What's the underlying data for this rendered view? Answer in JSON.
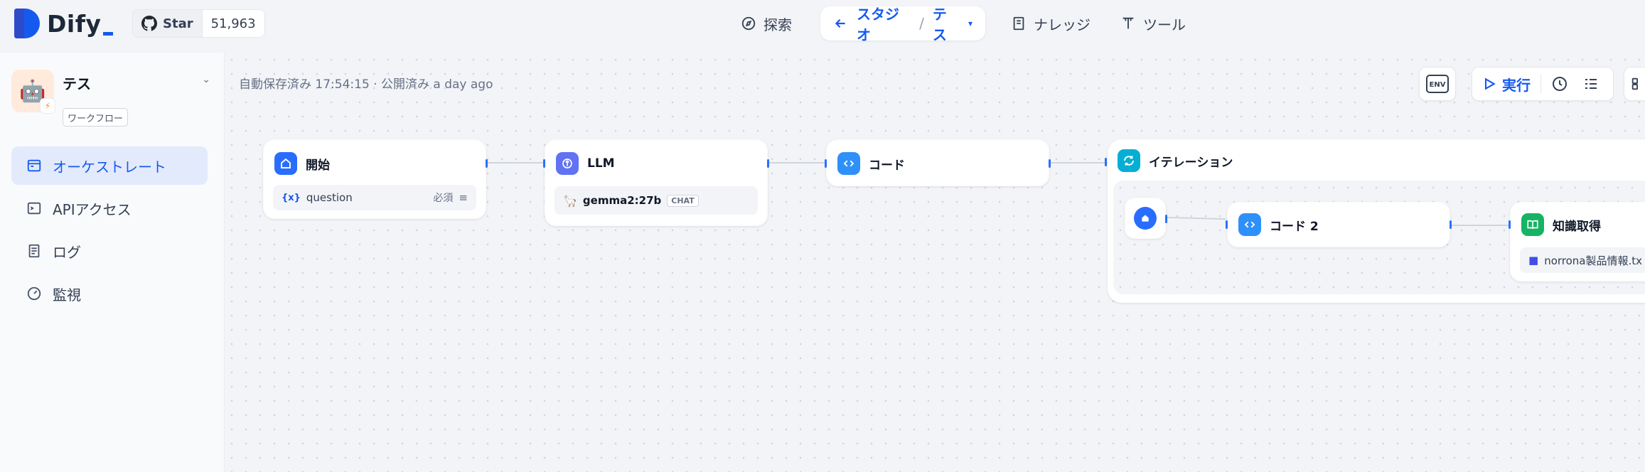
{
  "header": {
    "logo_text": "Dify",
    "github_star_label": "Star",
    "github_star_count": "51,963",
    "nav": {
      "explore": "探索",
      "studio": "スタジオ",
      "current_app": "テス",
      "knowledge": "ナレッジ",
      "tools": "ツール"
    }
  },
  "sidebar": {
    "app_name": "テス",
    "app_type": "ワークフロー",
    "items": [
      {
        "label": "オーケストレート",
        "active": true
      },
      {
        "label": "APIアクセス",
        "active": false
      },
      {
        "label": "ログ",
        "active": false
      },
      {
        "label": "監視",
        "active": false
      }
    ]
  },
  "canvas": {
    "status": "自動保存済み 17:54:15 · 公開済み a day ago",
    "env_label": "ENV",
    "run_label": "実行",
    "nodes": {
      "start": {
        "title": "開始",
        "var_name": "question",
        "required": "必須"
      },
      "llm": {
        "title": "LLM",
        "model": "gemma2:27b",
        "mode": "CHAT"
      },
      "code": {
        "title": "コード"
      },
      "iteration": {
        "title": "イテレーション"
      },
      "code2": {
        "title": "コード 2"
      },
      "knowledge": {
        "title": "知識取得",
        "dataset": "norrona製品情報.tx"
      }
    }
  },
  "colors": {
    "accent": "#155aef",
    "active_bg": "#e3eafc",
    "start_icon": "#296dff",
    "llm_icon": "#6172f3",
    "iteration_icon": "#06aed4",
    "knowledge_icon": "#16b364"
  }
}
